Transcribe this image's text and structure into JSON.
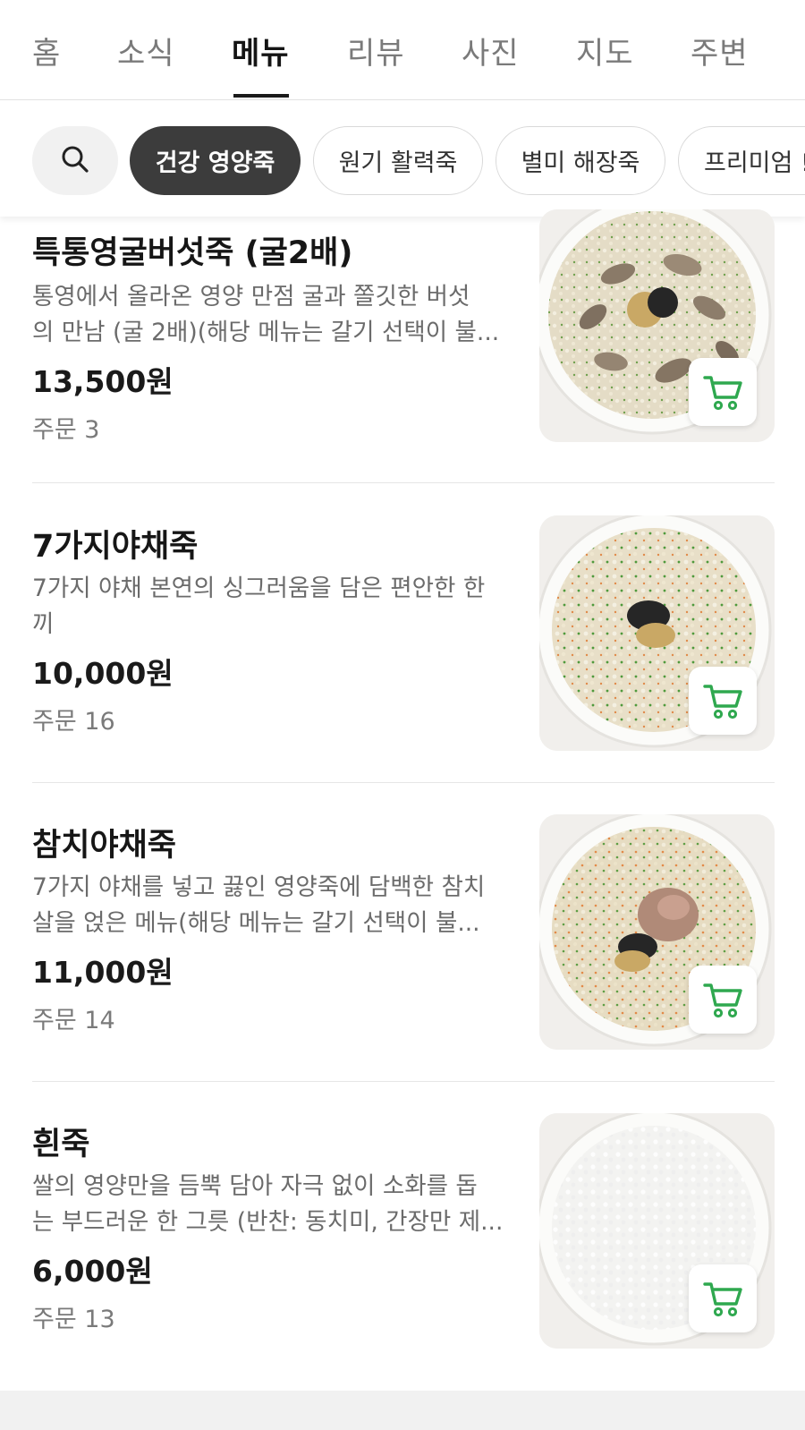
{
  "tabs": [
    {
      "label": "홈",
      "active": false
    },
    {
      "label": "소식",
      "active": false
    },
    {
      "label": "메뉴",
      "active": true
    },
    {
      "label": "리뷰",
      "active": false
    },
    {
      "label": "사진",
      "active": false
    },
    {
      "label": "지도",
      "active": false
    },
    {
      "label": "주변",
      "active": false
    }
  ],
  "filters": {
    "search_icon": "search-icon",
    "chips": [
      {
        "label": "건강 영양죽",
        "active": true
      },
      {
        "label": "원기 활력죽",
        "active": false
      },
      {
        "label": "별미 해장죽",
        "active": false
      },
      {
        "label": "프리미엄 !",
        "active": false
      }
    ]
  },
  "menu_items": [
    {
      "name": "특통영굴버섯죽 (굴2배)",
      "desc_line1": "통영에서 올라온 영양 만점 굴과 쫄깃한 버섯",
      "desc_line2": "의 만남 (굴 2배)(해당 메뉴는 갈기 선택이 불...",
      "price": "13,500원",
      "orders": "주문 3",
      "photo": "oyster-mushroom-porridge"
    },
    {
      "name": "7가지야채죽",
      "desc_line1": "7가지 야채 본연의 싱그러움을 담은 편안한 한",
      "desc_line2": "끼",
      "price": "10,000원",
      "orders": "주문 16",
      "photo": "vegetable-porridge"
    },
    {
      "name": "참치야채죽",
      "desc_line1": "7가지 야채를 넣고 끓인 영양죽에 담백한 참치",
      "desc_line2": "살을 얹은 메뉴(해당 메뉴는 갈기 선택이 불...",
      "price": "11,000원",
      "orders": "주문 14",
      "photo": "tuna-vegetable-porridge"
    },
    {
      "name": "흰죽",
      "desc_line1": "쌀의 영양만을 듬뿍 담아 자극 없이 소화를 돕",
      "desc_line2": "는 부드러운 한 그릇 (반찬: 동치미, 간장만 제...",
      "price": "6,000원",
      "orders": "주문 13",
      "photo": "plain-rice-porridge"
    }
  ],
  "colors": {
    "accent_green": "#2fa84f",
    "active_chip": "#3c3c3c"
  }
}
